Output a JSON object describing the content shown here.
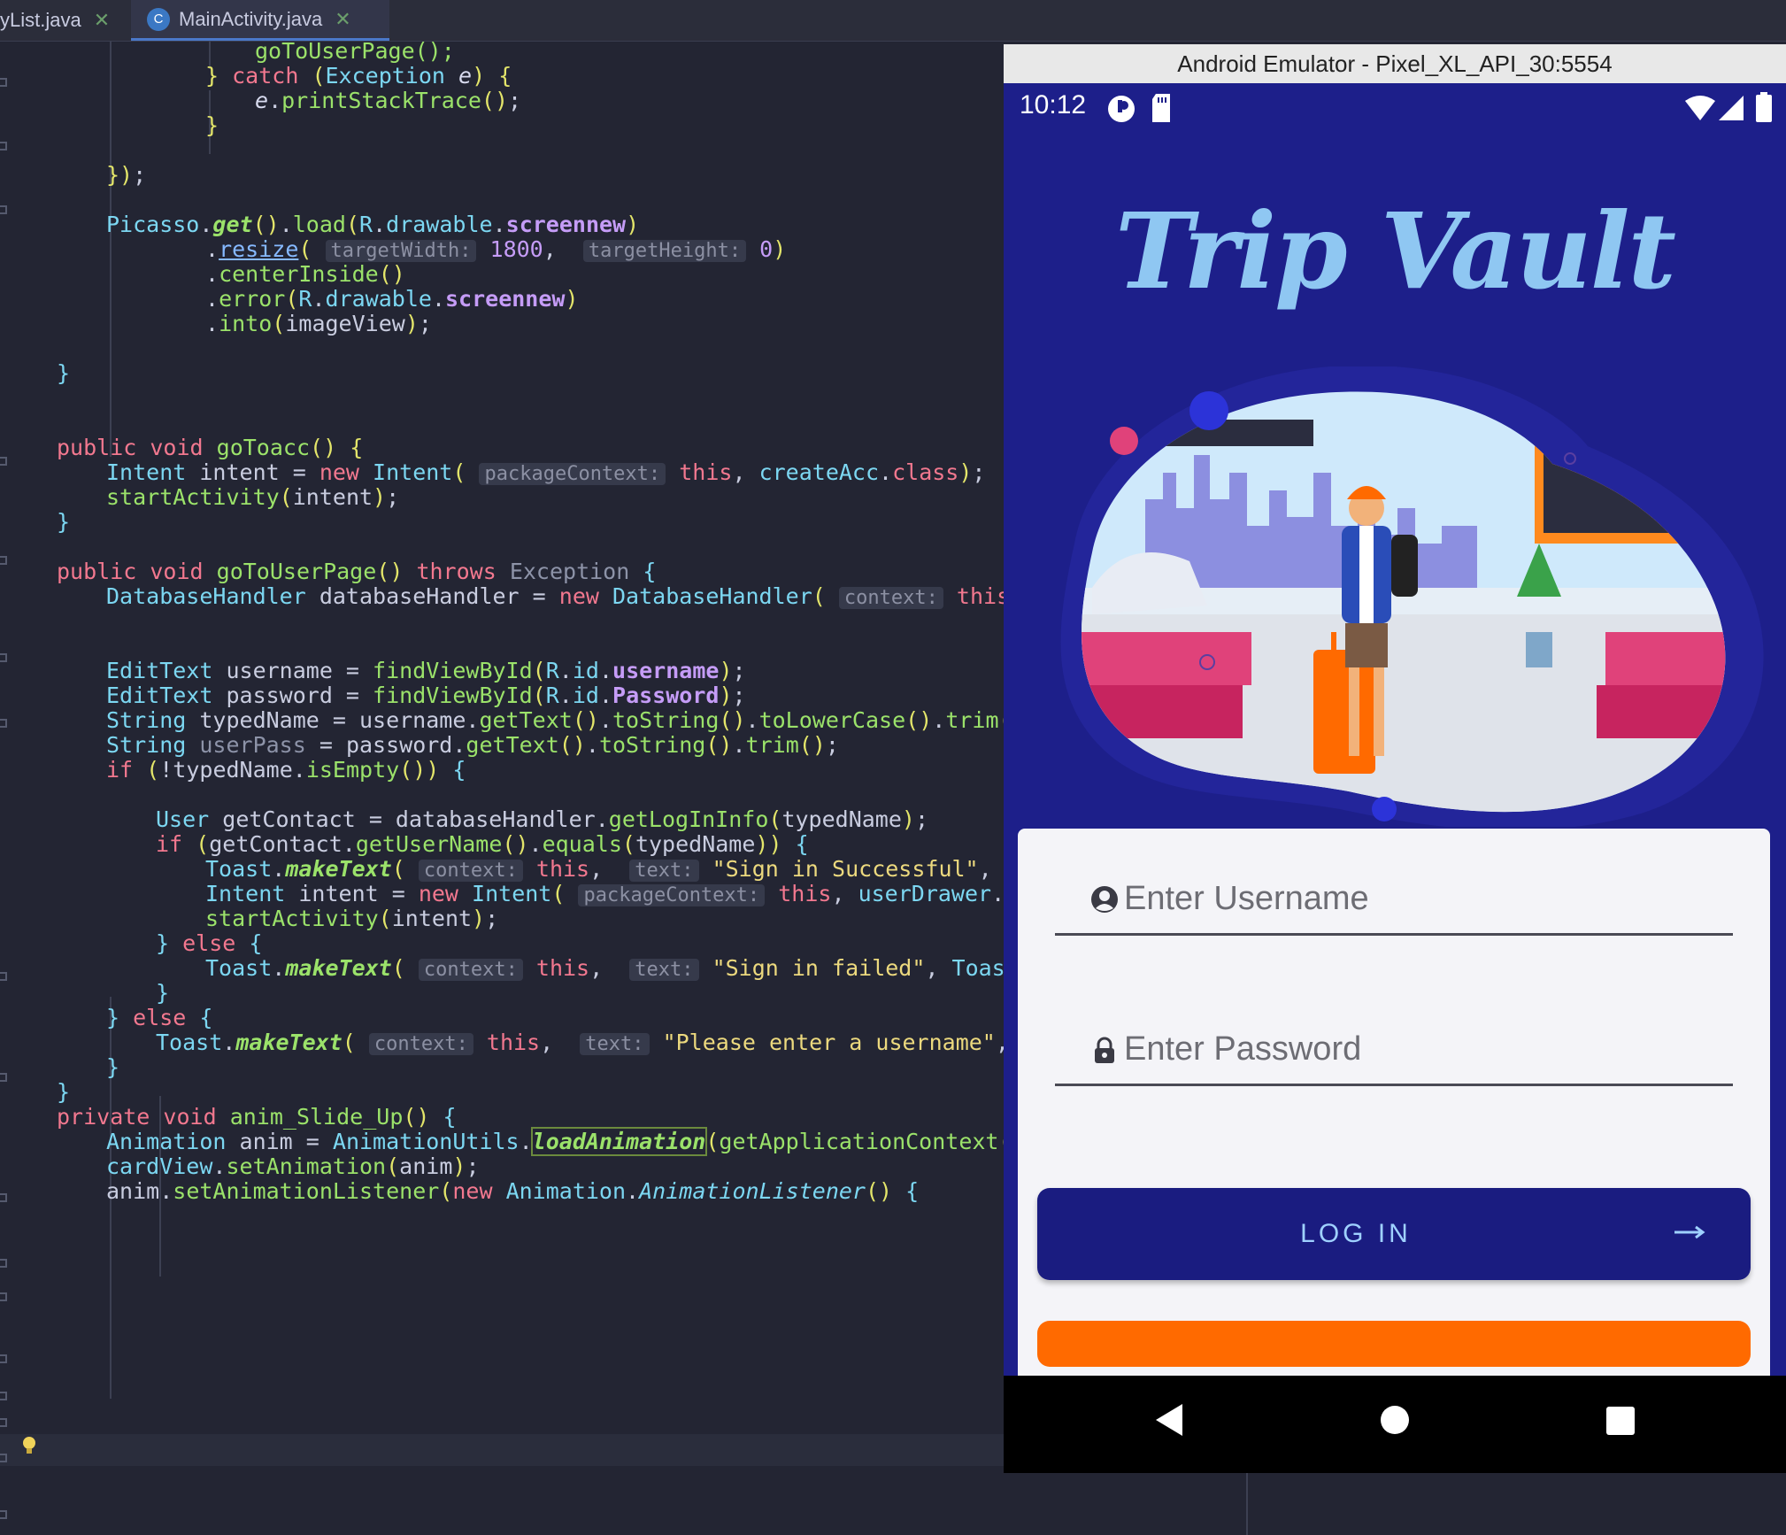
{
  "ide": {
    "tabs": [
      {
        "label": "yList.java",
        "active": false
      },
      {
        "label": "MainActivity.java",
        "active": true
      }
    ],
    "code_lines": [
      "goToUserPage();",
      "} catch (Exception e) {",
      "e.printStackTrace();",
      "}",
      "});",
      "Picasso.get().load(R.drawable.screennew)",
      ".resize( targetWidth: 1800,  targetHeight: 0)",
      ".centerInside()",
      ".error(R.drawable.screennew)",
      ".into(imageView);",
      "}",
      "public void goToacc() {",
      "Intent intent = new Intent( packageContext: this, createAcc.class);",
      "startActivity(intent);",
      "}",
      "public void goToUserPage() throws Exception {",
      "DatabaseHandler databaseHandler = new DatabaseHandler( context: this);",
      "EditText username = findViewById(R.id.username);",
      "EditText password = findViewById(R.id.Password);",
      "String typedName = username.getText().toString().toLowerCase().trim();",
      "String userPass = password.getText().toString().trim();",
      "if (!typedName.isEmpty()) {",
      "User getContact = databaseHandler.getLogInInfo(typedName);",
      "if (getContact.getUserName().equals(typedName)) {",
      "Toast.makeText( context: this,  text: \"Sign in Successful\", Toast.LE",
      "Intent intent = new Intent( packageContext: this, userDrawer.class",
      "startActivity(intent);",
      "} else {",
      "Toast.makeText( context: this,  text: \"Sign in failed\", Toast.LENGT",
      "}",
      "} else {",
      "Toast.makeText( context: this,  text: \"Please enter a username\", Toast.",
      "}",
      "}",
      "private void anim_Slide_Up() {",
      "Animation anim = AnimationUtils.loadAnimation(getApplicationContext(), R.",
      "cardView.setAnimation(anim);",
      "anim.setAnimationListener(new Animation.AnimationListener() {"
    ]
  },
  "emulator": {
    "title": "Android Emulator - Pixel_XL_API_30:5554",
    "status_time": "10:12",
    "app_logo_text": "Trip Vault",
    "username_placeholder": "Enter Username",
    "password_placeholder": "Enter Password",
    "login_label": "LOG IN",
    "colors": {
      "screen_bg": "#1d1f8a",
      "button_bg": "#1a1c80",
      "accent_orange": "#ff6a00",
      "logo_blue": "#8fc7f2"
    },
    "icons": [
      "person-icon",
      "lock-icon",
      "arrow-right-icon",
      "back-icon",
      "home-icon",
      "recents-icon",
      "wifi-icon",
      "signal-icon",
      "battery-icon"
    ]
  }
}
